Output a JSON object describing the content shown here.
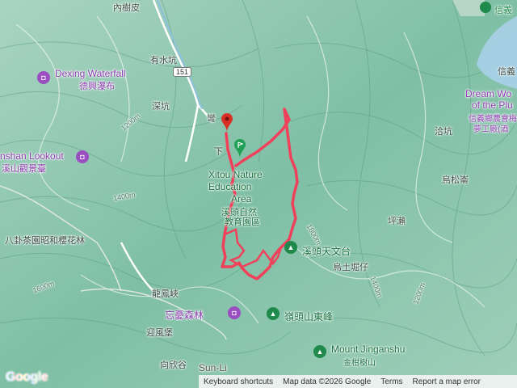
{
  "map": {
    "road_shield": "151",
    "places": [
      {
        "key": "neishupi",
        "text": "內樹皮"
      },
      {
        "key": "youshuikeng",
        "text": "有水坑"
      },
      {
        "key": "shenkeng",
        "text": "深坑"
      },
      {
        "key": "wanqiao",
        "text": "彎"
      },
      {
        "key": "xiakeng",
        "text": "下"
      },
      {
        "key": "qiankeng",
        "text": "洽坑"
      },
      {
        "key": "wusongzhai",
        "text": "烏松崙"
      },
      {
        "key": "pinglai",
        "text": "坪瀨"
      },
      {
        "key": "wutujueza",
        "text": "烏土堀仔"
      },
      {
        "key": "longfengxia",
        "text": "龍鳳峽"
      },
      {
        "key": "yingfengjian",
        "text": "迎風堡"
      },
      {
        "key": "xiaxinggu",
        "text": "向欣谷"
      },
      {
        "key": "guaxingcha",
        "text": "八卦茶園昭和櫻花林"
      }
    ],
    "pois": {
      "dexing_en": "Dexing Waterfall",
      "dexing_zh": "德興瀑布",
      "lookout_en": "nshan Lookout",
      "lookout_zh": "溪山觀景臺",
      "xitou_en_1": "Xitou Nature",
      "xitou_en_2": "Education",
      "xitou_en_3": "Area",
      "xitou_zh_1": "溪頭自然",
      "xitou_zh_2": "教育園區",
      "observatory": "溪頭天文台",
      "wangyou": "忘憂森林",
      "lingtou": "嶺頭山東峰",
      "jinganshu_en": "Mount Jinganshu",
      "jinganshu_zh": "金柑樹山",
      "dream_1": "Dream Wo",
      "dream_2": "of the Plu",
      "dream_3": "信義鄉農會梅",
      "dream_4": "夢工廠(酒",
      "xinyi": "信義",
      "xinyi2": "信義",
      "sunlink": "Sun-Li"
    },
    "contours": [
      "1200m",
      "1400m",
      "1600m",
      "1800m",
      "1400m",
      "1200m"
    ],
    "attribution": {
      "keyboard": "Keyboard shortcuts",
      "mapdata": "Map data ©2026 Google",
      "terms": "Terms",
      "report": "Report a map error"
    },
    "logo": "Google",
    "colors": {
      "track": "#f0405a",
      "start_marker": "#d93025",
      "end_marker": "#1fa055"
    }
  }
}
